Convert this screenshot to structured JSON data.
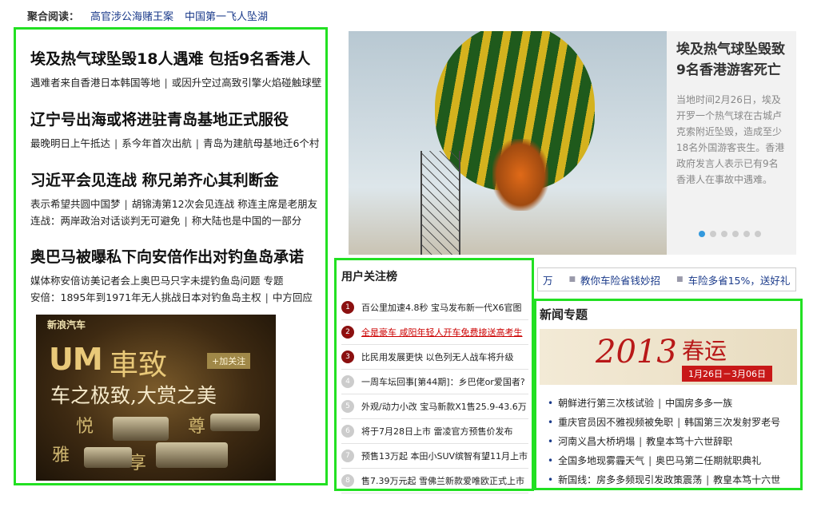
{
  "topbar": {
    "label": "聚合阅读：",
    "links": [
      "高官涉公海赌王案",
      "中国第一飞人坠湖"
    ]
  },
  "left_news": [
    {
      "title": "埃及热气球坠毁18人遇难 包括9名香港人",
      "lines": [
        [
          "遇难者来自香港日本韩国等地",
          "或因升空过高致引擎火焰碰触球壁"
        ]
      ]
    },
    {
      "title": "辽宁号出海或将进驻青岛基地正式服役",
      "lines": [
        [
          "最晚明日上午抵达",
          "系今年首次出航",
          "青岛为建航母基地迁6个村"
        ]
      ]
    },
    {
      "title": "习近平会见连战 称兄弟齐心其利断金",
      "lines": [
        [
          "表示希望共圆中国梦",
          "胡锦涛第12次会见连战 称连主席是老朋友"
        ],
        [
          "连战：两岸政治对话谈判无可避免",
          "称大陆也是中国的一部分"
        ]
      ]
    },
    {
      "title": "奥巴马被曝私下向安倍作出对钓鱼岛承诺",
      "lines": [
        [
          "媒体称安倍访美记者会上奥巴马只字未提钓鱼岛问题 专题"
        ],
        [
          "安倍：1895年到1971年无人挑战日本对钓鱼岛主权",
          "中方回应"
        ]
      ]
    }
  ],
  "ad": {
    "brand": "新浪汽车",
    "um": "UM",
    "name": "車致",
    "follow": "+加关注",
    "slogan": "车之极致,大赏之美",
    "chars": [
      "悦",
      "尊",
      "雅",
      "享"
    ]
  },
  "hero": {
    "title": "埃及热气球坠毁致9名香港游客死亡",
    "desc": "当地时间2月26日，埃及开罗一个热气球在古城卢克索附近坠毁，造成至少18名外国游客丧生。香港政府发言人表示已有9名香港人在事故中遇难。",
    "dot_count": 6,
    "active_dot": 1
  },
  "linksbar": {
    "lead": "万",
    "items": [
      "教你车险省钱妙招",
      "车险多省15%，送好礼"
    ]
  },
  "rank": {
    "title": "用户关注榜",
    "items": [
      {
        "n": "1",
        "text": "百公里加速4.8秒 宝马发布新一代X6官图"
      },
      {
        "n": "2",
        "text": "全是豪车 咸阳年轻人开车免费接送高考生"
      },
      {
        "n": "3",
        "text": "比民用发展更快 以色列无人战车将升级"
      },
      {
        "n": "4",
        "text": "一周车坛回事[第44期]：乡巴佬or爱国者?"
      },
      {
        "n": "5",
        "text": "外观/动力小改 宝马新款X1售25.9-43.6万"
      },
      {
        "n": "6",
        "text": "将于7月28日上市 雷凌官方预售价发布"
      },
      {
        "n": "7",
        "text": "预售13万起 本田小SUV缤智有望11月上市"
      },
      {
        "n": "8",
        "text": "售7.39万元起 雪佛兰新款爱唯欧正式上市"
      }
    ]
  },
  "topic": {
    "title": "新闻专题",
    "banner": {
      "year": "2013",
      "name": "春运",
      "dates": "1月26日－3月06日"
    },
    "items": [
      [
        "朝鲜进行第三次核试验",
        "中国房多多一族"
      ],
      [
        "重庆官员因不雅视频被免职",
        "韩国第三次发射罗老号"
      ],
      [
        "河南义昌大桥坍塌",
        "教皇本笃十六世辞职"
      ],
      [
        "全国多地现雾霾天气",
        "奥巴马第二任期就职典礼"
      ],
      [
        "新国线：房多多频现引发政策震荡",
        "教皇本笃十六世"
      ]
    ]
  },
  "colors": {
    "highlight_border": "#22e022",
    "link": "#1a3a8a",
    "rank_top": "#8b1010",
    "alert_red": "#c00000"
  }
}
